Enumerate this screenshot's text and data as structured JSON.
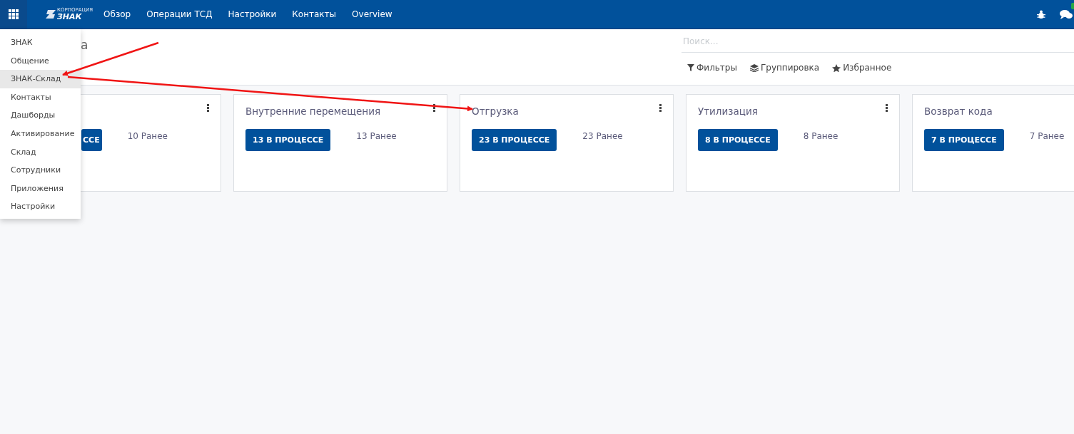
{
  "navbar": {
    "logo": {
      "caption": "КОРПОРАЦИЯ",
      "text": "ЗНАК"
    },
    "menu": [
      {
        "label": "Обзор"
      },
      {
        "label": "Операции ТСД"
      },
      {
        "label": "Настройки"
      },
      {
        "label": "Контакты"
      },
      {
        "label": "Overview"
      }
    ]
  },
  "apps_menu": {
    "items": [
      {
        "label": "ЗНАК",
        "selected": false
      },
      {
        "label": "Общение",
        "selected": false
      },
      {
        "label": "ЗНАК-Склад",
        "selected": true
      },
      {
        "label": "Контакты",
        "selected": false
      },
      {
        "label": "Дашборды",
        "selected": false
      },
      {
        "label": "Активирование",
        "selected": false
      },
      {
        "label": "Склад",
        "selected": false
      },
      {
        "label": "Сотрудники",
        "selected": false
      },
      {
        "label": "Приложения",
        "selected": false
      },
      {
        "label": "Настройки",
        "selected": false
      }
    ]
  },
  "control_panel": {
    "title": "а",
    "search": {
      "placeholder": "Поиск..."
    },
    "filters": [
      {
        "kind": "filter",
        "label": "Фильтры"
      },
      {
        "kind": "group",
        "label": "Группировка"
      },
      {
        "kind": "favorite",
        "label": "Избранное"
      }
    ]
  },
  "cards": [
    {
      "kind": "covered",
      "button": "ССЕ",
      "earlier": "10 Ранее"
    },
    {
      "kind": "full",
      "title": "Внутренние перемещения",
      "button": "13 В ПРОЦЕССЕ",
      "earlier": "13 Ранее"
    },
    {
      "kind": "full",
      "title": "Отгрузка",
      "button": "23 В ПРОЦЕССЕ",
      "earlier": "23 Ранее"
    },
    {
      "kind": "full",
      "title": "Утилизация",
      "button": "8 В ПРОЦЕССЕ",
      "earlier": "8 Ранее"
    },
    {
      "kind": "full",
      "title": "Возврат кода",
      "button": "7 В ПРОЦЕССЕ",
      "earlier": "7 Ранее"
    }
  ]
}
